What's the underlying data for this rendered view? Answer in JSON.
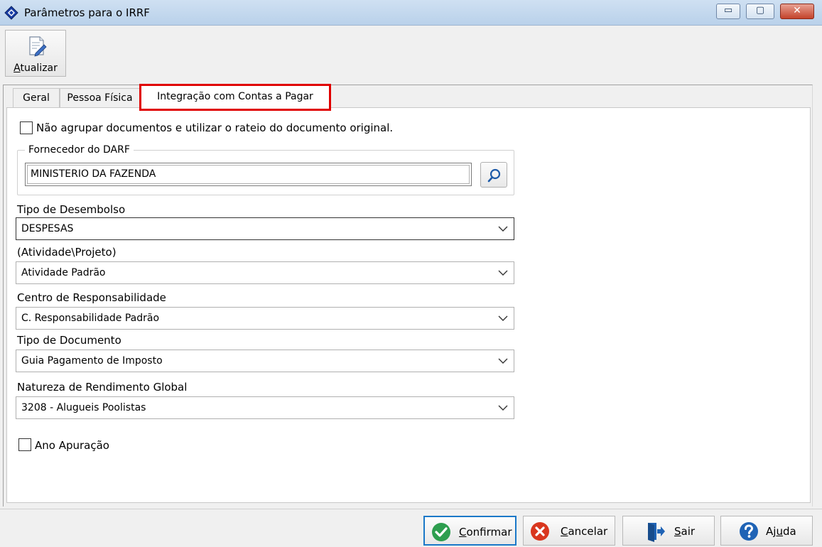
{
  "window": {
    "title": "Parâmetros para o IRRF",
    "minimize_glyph": "▭",
    "maximize_glyph": "▢",
    "close_glyph": "✕"
  },
  "toolbar": {
    "update_label_first": "A",
    "update_label_rest": "tualizar",
    "update_icon": "edit-document-icon"
  },
  "tabs": [
    {
      "label": "Geral"
    },
    {
      "label": "Pessoa Física"
    },
    {
      "label": "Integração com Contas a Pagar",
      "active": true,
      "highlight_color": "#e00000"
    }
  ],
  "form": {
    "no_group_checkbox": {
      "label": "Não agrupar documentos e utilizar o rateio do documento original.",
      "checked": false
    },
    "supplier_group": {
      "legend": "Fornecedor do DARF",
      "value": "MINISTERIO DA FAZENDA",
      "search_icon": "search-icon"
    },
    "disbursement_type": {
      "label": "Tipo de Desembolso",
      "value": "DESPESAS"
    },
    "activity_project": {
      "label": "(Atividade\\Projeto)",
      "value": "Atividade Padrão"
    },
    "responsibility_center": {
      "label": "Centro de Responsabilidade",
      "value": "C. Responsabilidade Padrão"
    },
    "document_type": {
      "label": "Tipo de Documento",
      "value": "Guia Pagamento de Imposto"
    },
    "income_nature": {
      "label": "Natureza de Rendimento Global",
      "value": "3208 - Alugueis Poolistas"
    },
    "year_checkbox": {
      "label": "Ano Apuração",
      "checked": false
    }
  },
  "buttons": {
    "confirm": {
      "first": "C",
      "rest": "onfirmar",
      "icon": "check-circle-icon",
      "color": "#2e9e4f"
    },
    "cancel": {
      "first": "C",
      "rest": "ancelar",
      "icon": "x-circle-icon",
      "color": "#d9361e"
    },
    "exit": {
      "first": "S",
      "rest": "air",
      "icon": "exit-door-icon",
      "color": "#1f63b5"
    },
    "help": {
      "pre": "Aj",
      "ul": "u",
      "post": "da",
      "icon": "help-circle-icon",
      "color": "#1f63b5"
    }
  }
}
